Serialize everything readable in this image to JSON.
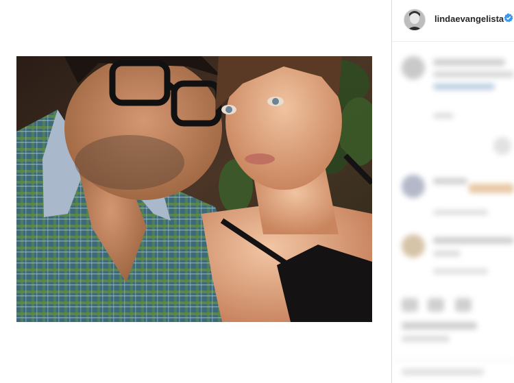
{
  "post": {
    "author": {
      "username": "lindaevangelista",
      "verified": true,
      "avatar_icon": "profile-avatar"
    },
    "photo": {
      "kind": "selfie-photo"
    }
  },
  "colors": {
    "verified_badge": "#3897f0",
    "divider": "#dbdbdb",
    "text_primary": "#262626"
  }
}
